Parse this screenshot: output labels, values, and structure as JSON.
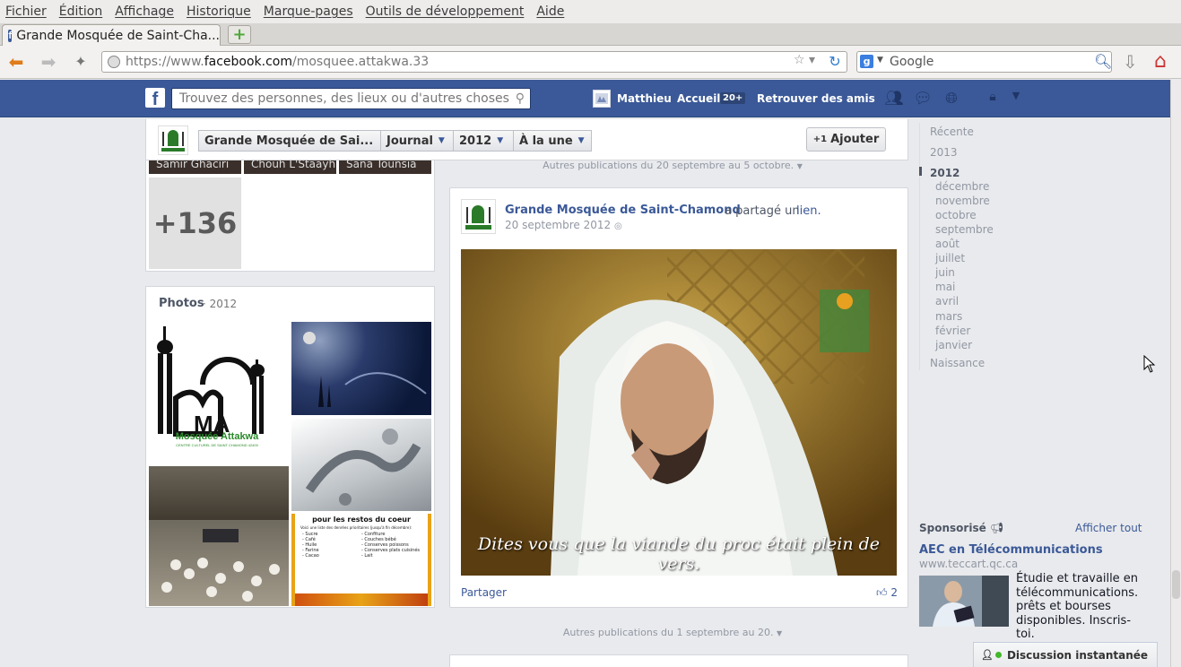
{
  "menubar": [
    "Fichier",
    "Édition",
    "Affichage",
    "Historique",
    "Marque-pages",
    "Outils de développement",
    "Aide"
  ],
  "tab": {
    "title": "Grande Mosquée de Saint-Cha..."
  },
  "urlbar": {
    "prefix": "https://www.",
    "domain": "facebook.com",
    "path": "/mosquee.attakwa.33"
  },
  "searchbar": {
    "placeholder": "Google"
  },
  "fb": {
    "search_placeholder": "Trouvez des personnes, des lieux ou d'autres choses",
    "user": "Matthieu",
    "home": "Accueil",
    "home_badge": "20+",
    "find_friends": "Retrouver des amis"
  },
  "timeline_header": {
    "name": "Grande Mosquée de Sai...",
    "journal": "Journal",
    "year": "2012",
    "filter": "À la une",
    "add_button": "Ajouter"
  },
  "friends": {
    "names": [
      "Samir Ghaciri",
      "Chouh L'Staayh",
      "Sana Tounsia"
    ],
    "more": "+136"
  },
  "photos": {
    "title": "Photos",
    "year": "· 2012",
    "logo_text": "Mosquée Attakwa",
    "logo_sub": "CENTRE CULTUREL DE SAINT CHAMOND 42400",
    "flyer_title": "pour les restos du coeur",
    "flyer_lines": [
      "Voici une liste des denrées prioritaires (jusqu'à fin décembre):",
      "- Sucre",
      "- Café",
      "- Huile",
      "- Farine",
      "- Cacao",
      "- Confiture",
      "- Couches bébé",
      "- Conserves poissons",
      "- Conserves plats cuisinés",
      "- Lait"
    ]
  },
  "feed": {
    "separator_top": "Autres publications du 20 septembre au 5 octobre.",
    "post": {
      "author": "Grande Mosquée de Saint-Chamond",
      "verb": "a partagé un",
      "link": "lien.",
      "date": "20 septembre 2012",
      "subtitle": "Dites vous que la viande du proc était plein de vers.",
      "share": "Partager",
      "likes": "2"
    },
    "separator_bottom": "Autres publications du 1 septembre au 20."
  },
  "yearnav": {
    "recent": "Récente",
    "y2013": "2013",
    "y2012": "2012",
    "months": [
      "décembre",
      "novembre",
      "octobre",
      "septembre",
      "août",
      "juillet",
      "juin",
      "mai",
      "avril",
      "mars",
      "février",
      "janvier"
    ],
    "birth": "Naissance"
  },
  "sponsored": {
    "title": "Sponsorisé",
    "see_all": "Afficher tout",
    "ad_title": "AEC en Télécommunications",
    "ad_url": "www.teccart.qc.ca",
    "ad_text": "Étudie et travaille en télécommunications. prêts et bourses disponibles. Inscris-toi."
  },
  "chat": {
    "label": "Discussion instantanée"
  },
  "colors": {
    "fb_blue": "#3b5998",
    "link": "#3b5998",
    "page_bg": "#e9eaed"
  }
}
